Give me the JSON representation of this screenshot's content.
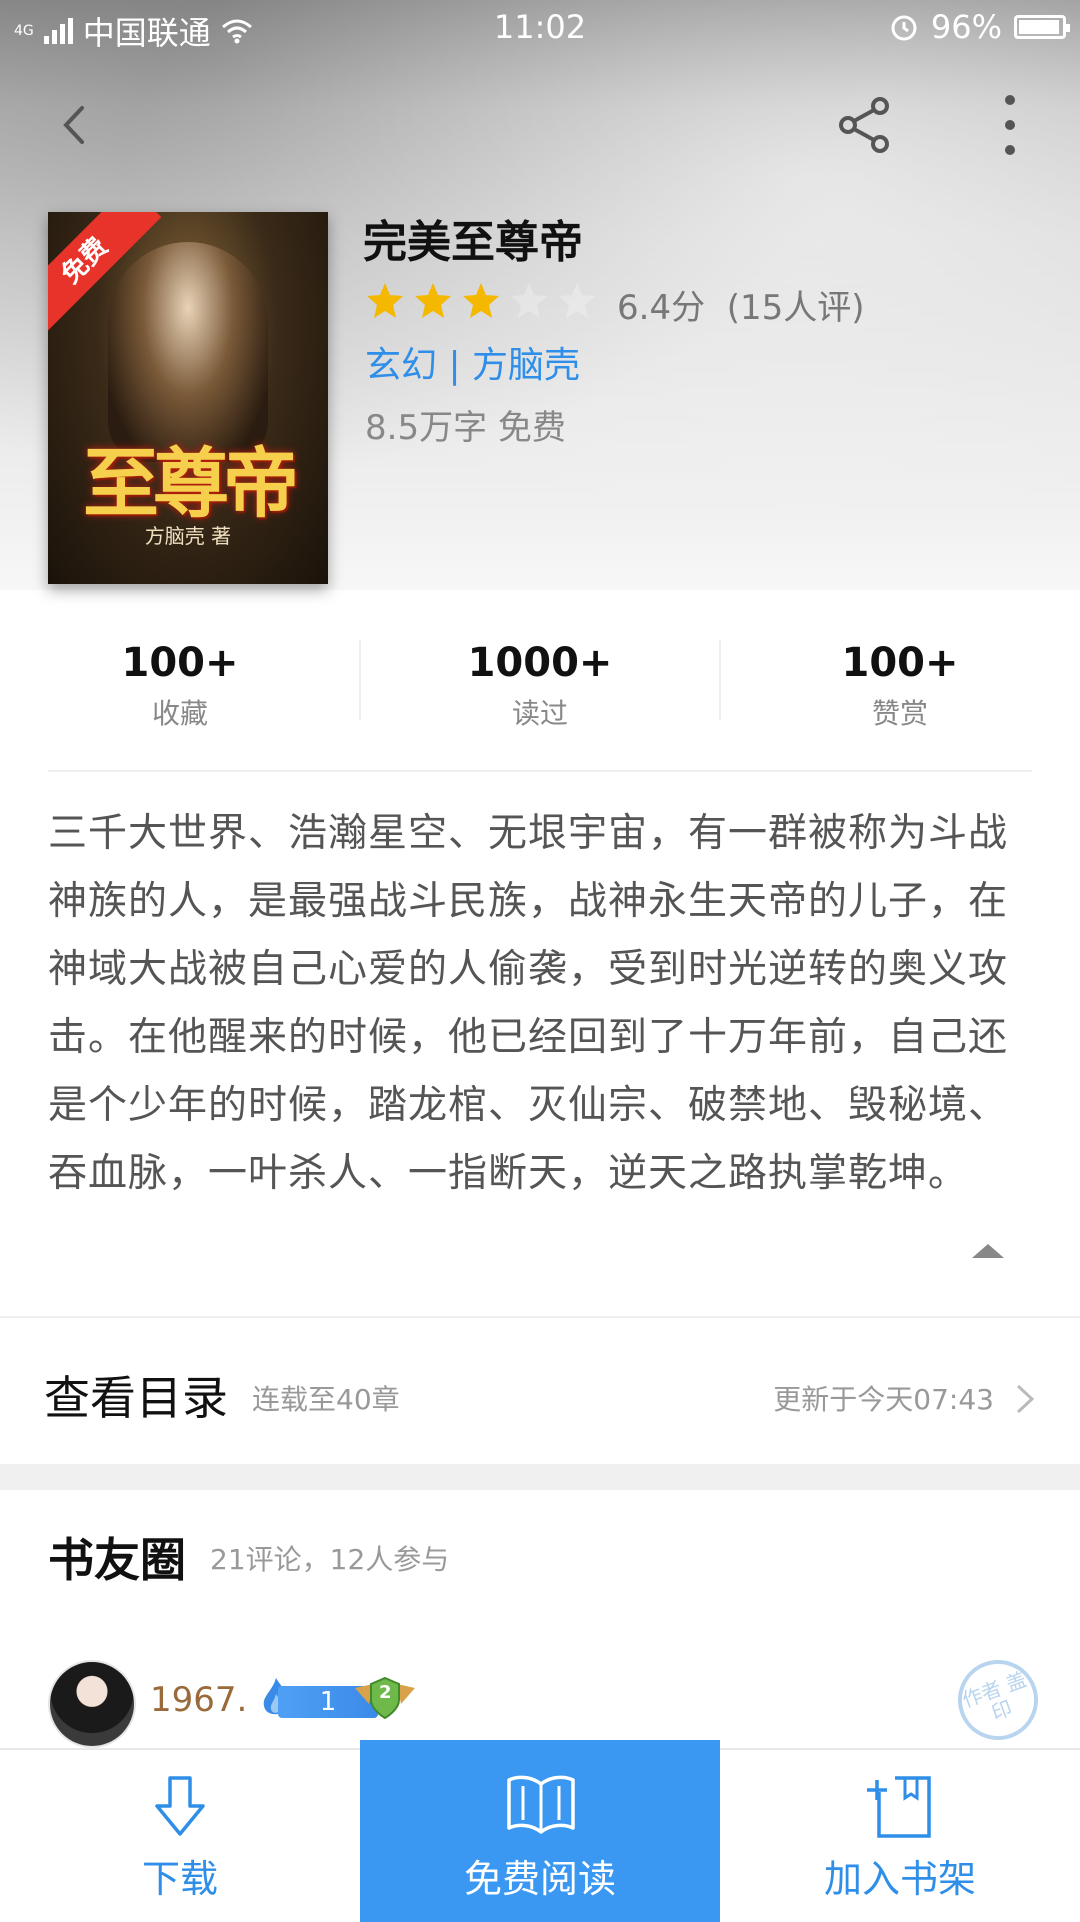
{
  "status_bar": {
    "network_type": "4G",
    "carrier": "中国联通",
    "time": "11:02",
    "battery": "96%",
    "battery_level": 0.96
  },
  "top_bar": {
    "back_icon": "chevron-left-icon",
    "share_icon": "share-icon",
    "more_icon": "more-vertical-icon"
  },
  "book": {
    "cover": {
      "free_badge": "免费",
      "cover_title": "至尊帝",
      "cover_author": "方脑壳 著"
    },
    "title": "完美至尊帝",
    "stars_filled": 3,
    "stars_total": 5,
    "rating": "6.4分",
    "rating_count": "(15人评)",
    "genre_author": "玄幻 | 方脑壳",
    "meta": "8.5万字  免费"
  },
  "stats": [
    {
      "value": "100+",
      "label": "收藏"
    },
    {
      "value": "1000+",
      "label": "读过"
    },
    {
      "value": "100+",
      "label": "赞赏"
    }
  ],
  "description": "三千大世界、浩瀚星空、无垠宇宙，有一群被称为斗战神族的人，是最强战斗民族，战神永生天帝的儿子，在神域大战被自己心爱的人偷袭，受到时光逆转的奥义攻击。在他醒来的时候，他已经回到了十万年前，自己还是个少年的时候，踏龙棺、灭仙宗、破禁地、毁秘境、吞血脉，一叶杀人、一指断天，逆天之路执掌乾坤。",
  "catalog": {
    "title": "查看目录",
    "subtitle": "连载至40章",
    "update": "更新于今天07:43"
  },
  "book_circle": {
    "title": "书友圈",
    "subtitle": "21评论，12人参与",
    "comments": [
      {
        "username": "1967.",
        "level": "1",
        "rank": "2",
        "stamp": "作者 盖印"
      }
    ]
  },
  "bottom_bar": {
    "download": "下载",
    "read": "免费阅读",
    "add_shelf": "加入书架"
  },
  "colors": {
    "accent": "#2e8ee8",
    "read_button": "#3a97f2",
    "star": "#f5b800",
    "free_badge": "#e8332a"
  }
}
